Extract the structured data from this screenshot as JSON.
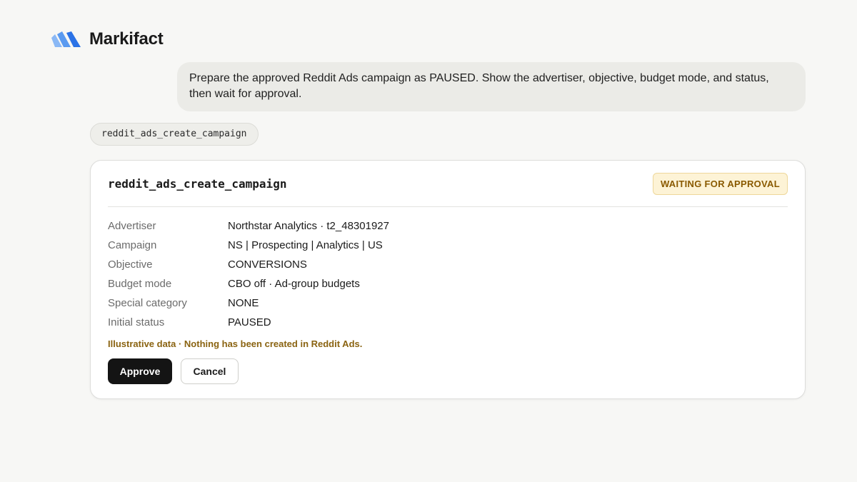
{
  "brand": {
    "name": "Markifact",
    "logo_icon": "markifact-logo-icon",
    "colors": {
      "light": "#8ab8f5",
      "mid": "#5a9af0",
      "dark": "#2b72e6"
    }
  },
  "conversation": {
    "user_message": "Prepare the approved Reddit Ads campaign as PAUSED. Show the advertiser, objective, budget mode, and status, then wait for approval.",
    "tool_chip": "reddit_ads_create_campaign"
  },
  "card": {
    "title": "reddit_ads_create_campaign",
    "status": "WAITING FOR APPROVAL",
    "rows": [
      {
        "label": "Advertiser",
        "value": "Northstar Analytics · t2_48301927"
      },
      {
        "label": "Campaign",
        "value": "NS | Prospecting | Analytics | US"
      },
      {
        "label": "Objective",
        "value": "CONVERSIONS"
      },
      {
        "label": "Budget mode",
        "value": "CBO off · Ad-group budgets"
      },
      {
        "label": "Special category",
        "value": "NONE"
      },
      {
        "label": "Initial status",
        "value": "PAUSED"
      }
    ],
    "disclaimer": "Illustrative data · Nothing has been created in Reddit Ads.",
    "approve_label": "Approve",
    "cancel_label": "Cancel"
  }
}
